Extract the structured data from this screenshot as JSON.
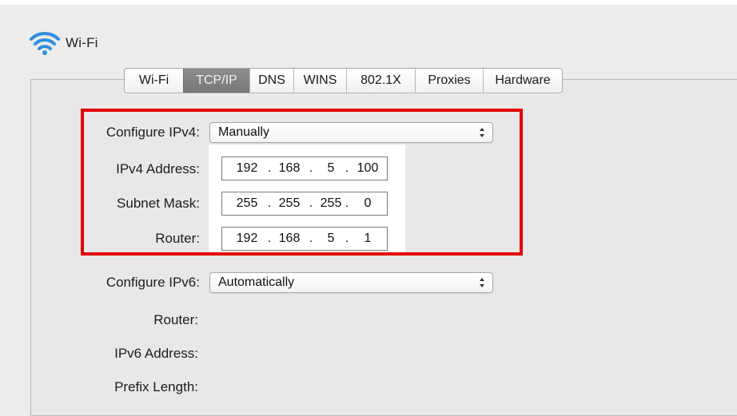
{
  "header": {
    "title": "Wi-Fi",
    "icon": "wifi-icon"
  },
  "tabs": [
    {
      "label": "Wi-Fi",
      "active": false
    },
    {
      "label": "TCP/IP",
      "active": true
    },
    {
      "label": "DNS",
      "active": false
    },
    {
      "label": "WINS",
      "active": false
    },
    {
      "label": "802.1X",
      "active": false
    },
    {
      "label": "Proxies",
      "active": false
    },
    {
      "label": "Hardware",
      "active": false
    }
  ],
  "ipv4": {
    "configure_label": "Configure IPv4:",
    "configure_value": "Manually",
    "address_label": "IPv4 Address:",
    "address": [
      "192",
      "168",
      "5",
      "100"
    ],
    "subnet_label": "Subnet Mask:",
    "subnet": [
      "255",
      "255",
      "255",
      "0"
    ],
    "router_label": "Router:",
    "router": [
      "192",
      "168",
      "5",
      "1"
    ]
  },
  "ipv6": {
    "configure_label": "Configure IPv6:",
    "configure_value": "Automatically",
    "router_label": "Router:",
    "address_label": "IPv6 Address:",
    "prefix_label": "Prefix Length:"
  },
  "octet_separator": ".",
  "colors": {
    "highlight": "#e20000",
    "active_tab": "#7f7f7f",
    "wifi": "#2f8fe0"
  }
}
